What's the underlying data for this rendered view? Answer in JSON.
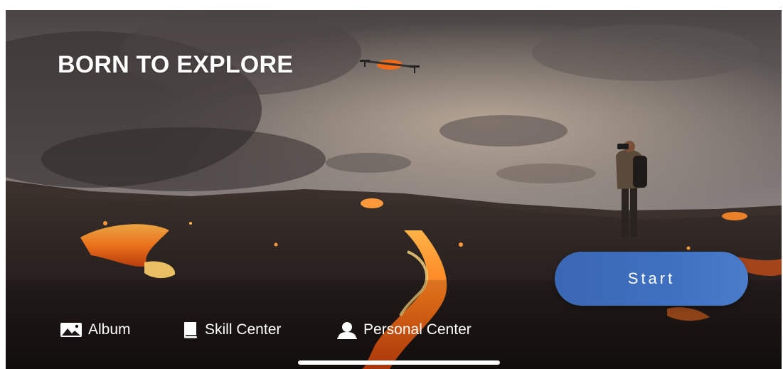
{
  "hero": {
    "headline": "BORN TO EXPLORE",
    "image": "volcanic lava field at dusk with photographer and drone"
  },
  "actions": {
    "start_label": "Start",
    "accent": "#3d6cbd"
  },
  "nav": {
    "items": [
      {
        "label": "Album",
        "icon": "album-icon"
      },
      {
        "label": "Skill Center",
        "icon": "book-icon"
      },
      {
        "label": "Personal Center",
        "icon": "person-icon"
      }
    ]
  },
  "colors": {
    "lava": "#ff7a1a",
    "text": "#ffffff"
  }
}
